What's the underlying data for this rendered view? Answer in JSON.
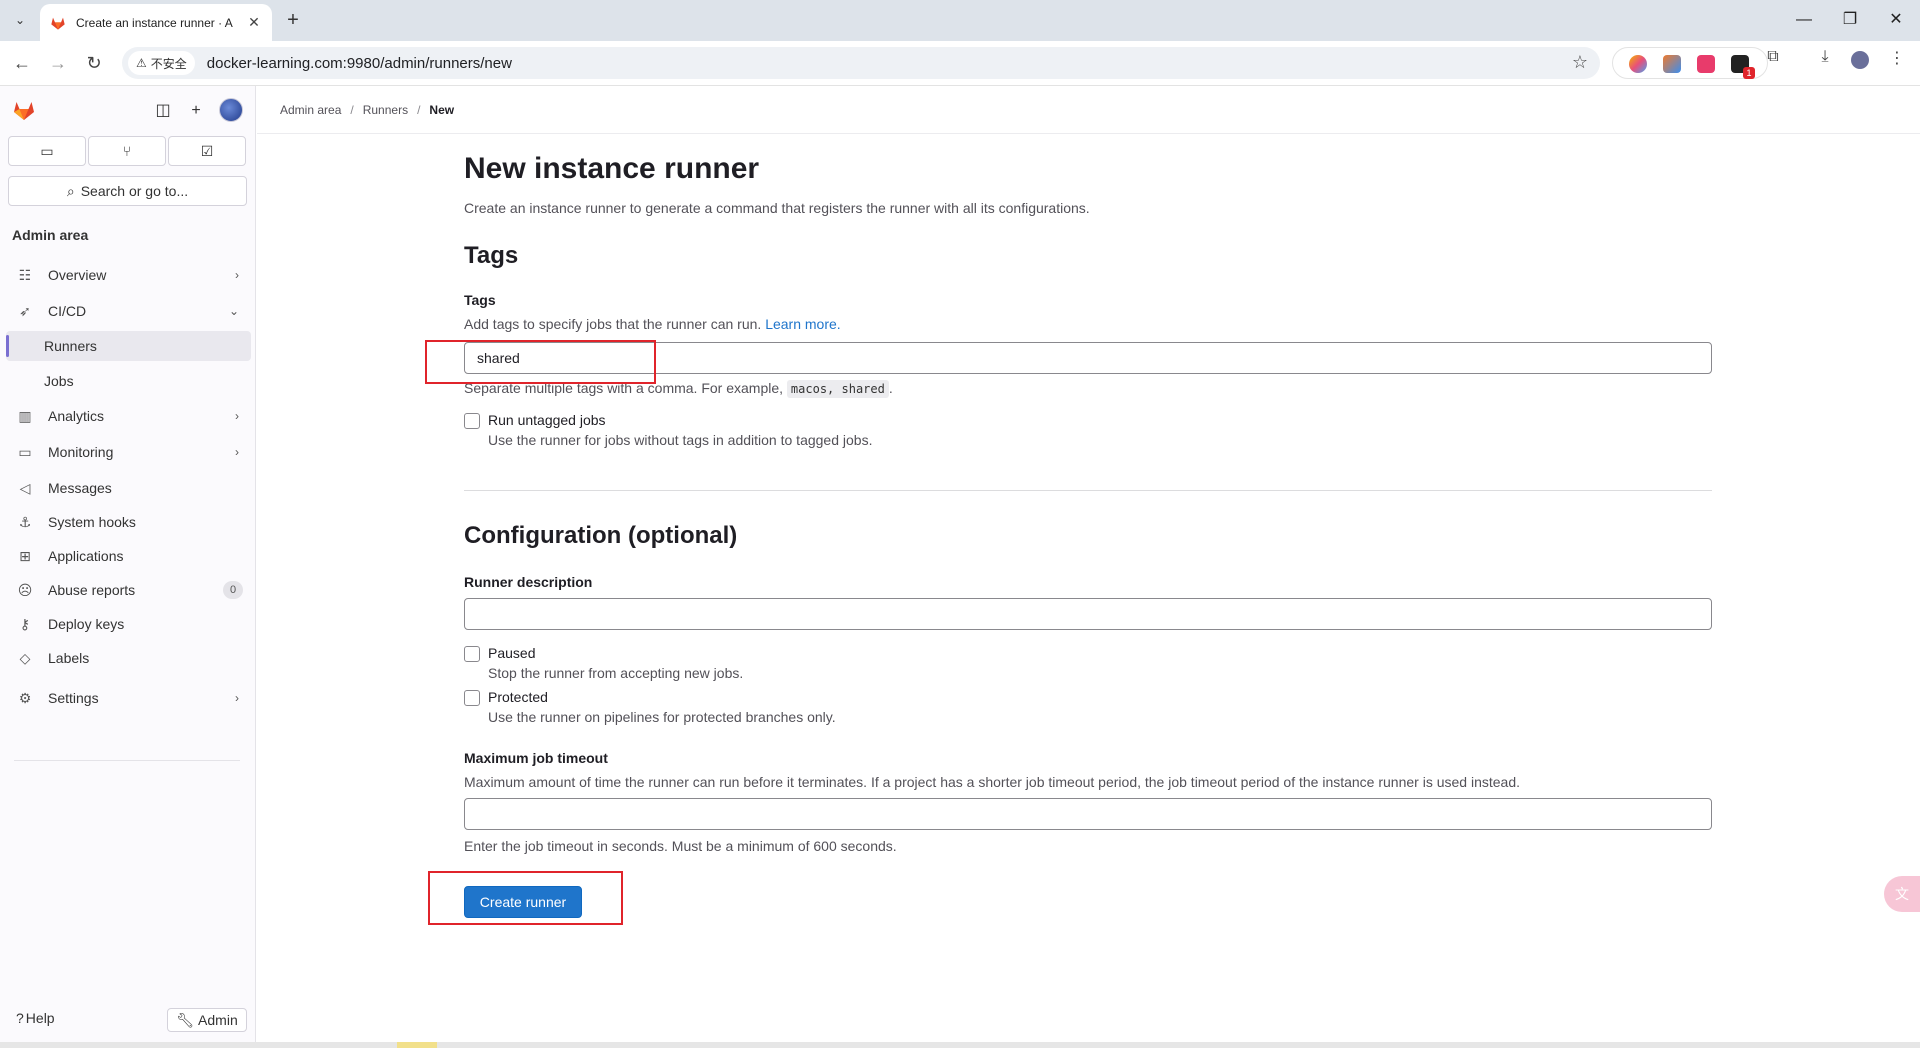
{
  "browser": {
    "tab_title": "Create an instance runner · A",
    "security_label": "不安全",
    "url": "docker-learning.com:9980/admin/runners/new",
    "ext_badge": "1"
  },
  "sidebar": {
    "search_placeholder": "Search or go to...",
    "section_title": "Admin area",
    "items": [
      {
        "label": "Overview"
      },
      {
        "label": "CI/CD"
      },
      {
        "label": "Runners"
      },
      {
        "label": "Jobs"
      },
      {
        "label": "Analytics"
      },
      {
        "label": "Monitoring"
      },
      {
        "label": "Messages"
      },
      {
        "label": "System hooks"
      },
      {
        "label": "Applications"
      },
      {
        "label": "Abuse reports",
        "badge": "0"
      },
      {
        "label": "Deploy keys"
      },
      {
        "label": "Labels"
      },
      {
        "label": "Settings"
      }
    ],
    "help_label": "Help",
    "admin_label": "Admin"
  },
  "breadcrumb": {
    "items": [
      "Admin area",
      "Runners",
      "New"
    ]
  },
  "page": {
    "title": "New instance runner",
    "description": "Create an instance runner to generate a command that registers the runner with all its configurations.",
    "tags_heading": "Tags",
    "tags_label": "Tags",
    "tags_help": "Add tags to specify jobs that the runner can run.",
    "tags_help_link": "Learn more.",
    "tags_value": "shared",
    "tags_hint_prefix": "Separate multiple tags with a comma. For example,",
    "tags_hint_code": "macos, shared",
    "tags_hint_suffix": ".",
    "run_untagged_label": "Run untagged jobs",
    "run_untagged_help": "Use the runner for jobs without tags in addition to tagged jobs.",
    "config_heading": "Configuration (optional)",
    "description_label": "Runner description",
    "description_value": "",
    "paused_label": "Paused",
    "paused_help": "Stop the runner from accepting new jobs.",
    "protected_label": "Protected",
    "protected_help": "Use the runner on pipelines for protected branches only.",
    "timeout_label": "Maximum job timeout",
    "timeout_help": "Maximum amount of time the runner can run before it terminates. If a project has a shorter job timeout period, the job timeout period of the instance runner is used instead.",
    "timeout_value": "",
    "timeout_hint": "Enter the job timeout in seconds. Must be a minimum of 600 seconds.",
    "submit_label": "Create runner"
  },
  "colors": {
    "accent": "#1f75cb",
    "highlight_box": "#e0242b",
    "sidebar_active_marker": "#7a6fd1"
  }
}
